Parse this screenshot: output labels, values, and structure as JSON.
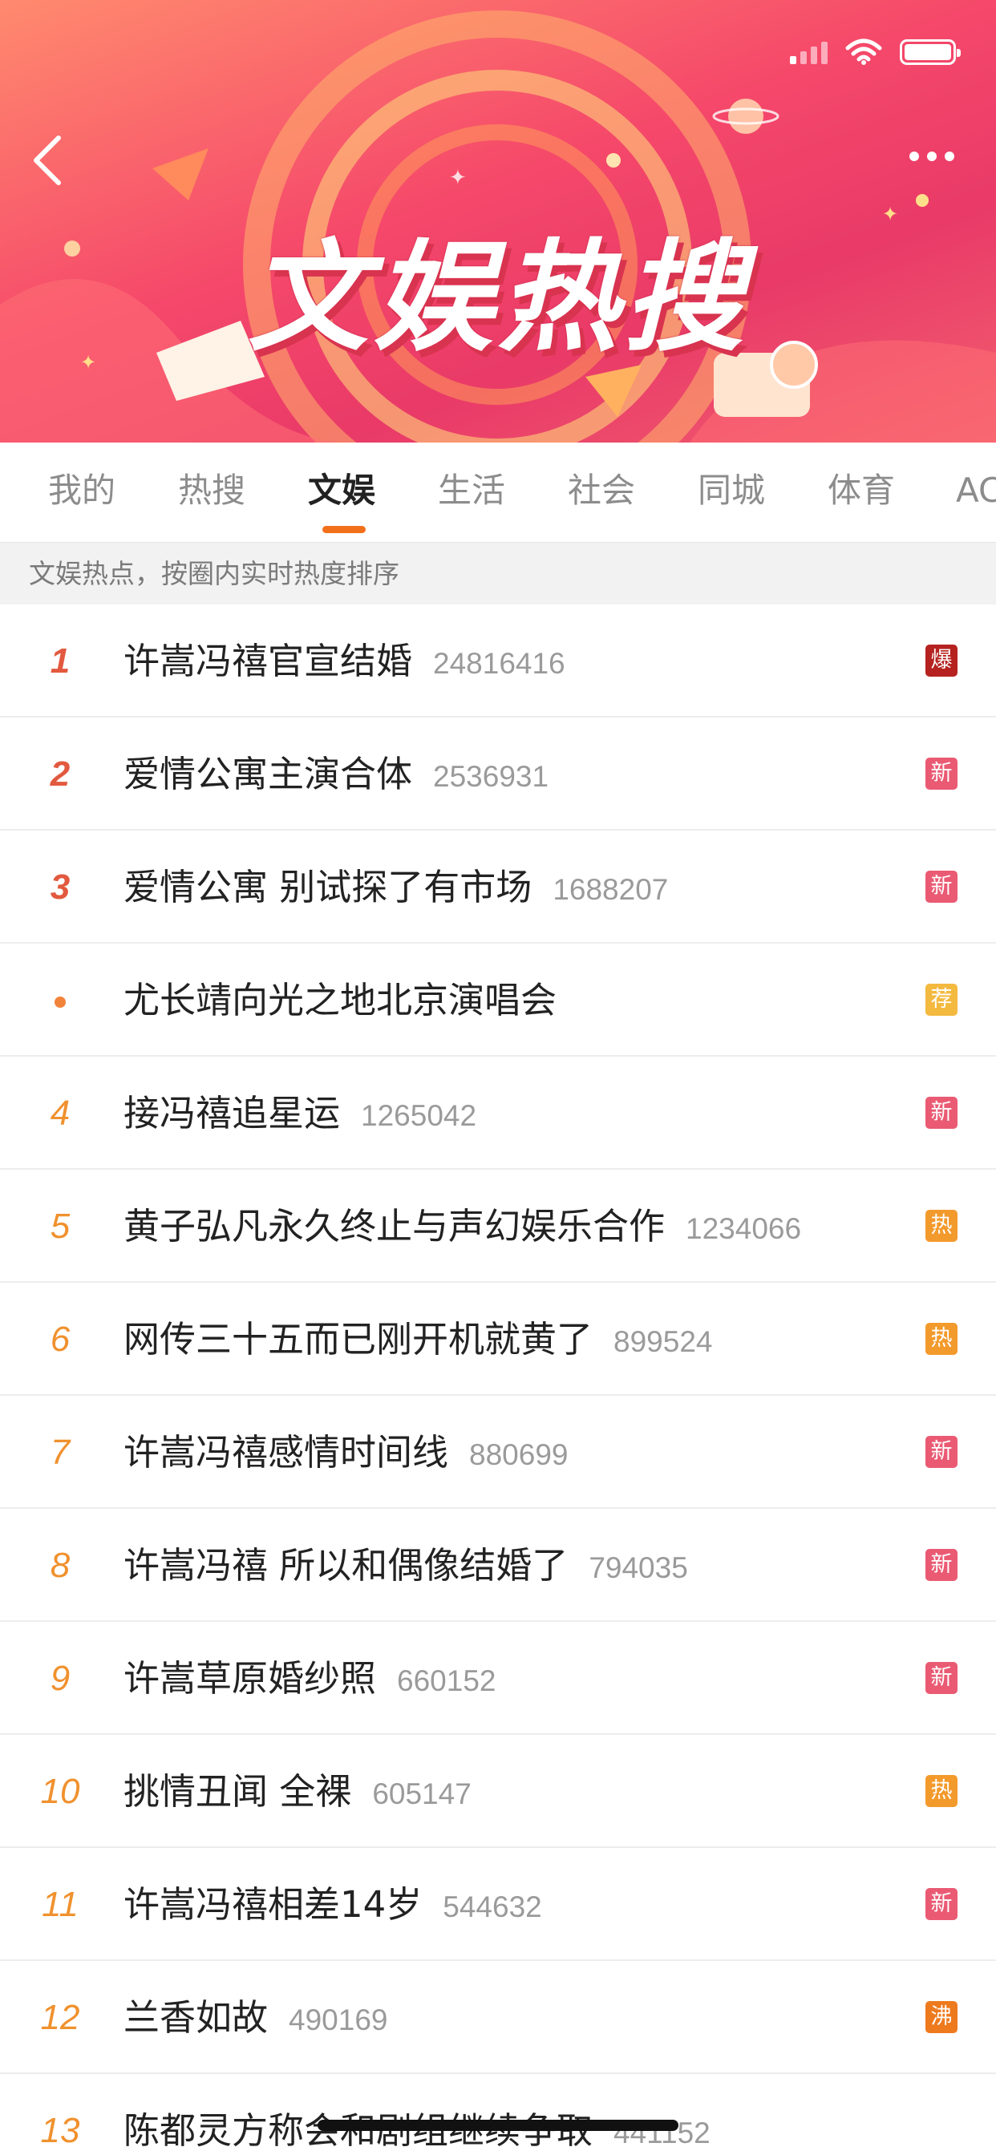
{
  "banner": {
    "title": "文娱热搜",
    "back_icon": "chevron-left-icon",
    "more_icon": "more-dots-icon",
    "colors": {
      "gradient_start": "#ff8a6e",
      "gradient_mid": "#f5486a",
      "gradient_end": "#e93a68"
    }
  },
  "tabs": [
    {
      "label": "我的",
      "active": false
    },
    {
      "label": "热搜",
      "active": false
    },
    {
      "label": "文娱",
      "active": true
    },
    {
      "label": "生活",
      "active": false
    },
    {
      "label": "社会",
      "active": false
    },
    {
      "label": "同城",
      "active": false
    },
    {
      "label": "体育",
      "active": false
    },
    {
      "label": "AC",
      "active": false
    }
  ],
  "subheader": {
    "text": "文娱热点，按圈内实时热度排序"
  },
  "accent_color": "#f2701a",
  "badge_colors": {
    "爆": "#b5221f",
    "新": "#ea5a73",
    "荐": "#f4b93f",
    "热": "#f39a2c",
    "沸": "#ee7a1e"
  },
  "list": [
    {
      "rank": "1",
      "title": "许嵩冯禧官宣结婚",
      "count": "24816416",
      "badge": "爆"
    },
    {
      "rank": "2",
      "title": "爱情公寓主演合体",
      "count": "2536931",
      "badge": "新"
    },
    {
      "rank": "3",
      "title": "爱情公寓 别试探了有市场",
      "count": "1688207",
      "badge": "新"
    },
    {
      "rank": "",
      "title": "尤长靖向光之地北京演唱会",
      "count": "",
      "badge": "荐"
    },
    {
      "rank": "4",
      "title": "接冯禧追星运",
      "count": "1265042",
      "badge": "新"
    },
    {
      "rank": "5",
      "title": "黄子弘凡永久终止与声幻娱乐合作",
      "count": "1234066",
      "badge": "热"
    },
    {
      "rank": "6",
      "title": "网传三十五而已刚开机就黄了",
      "count": "899524",
      "badge": "热"
    },
    {
      "rank": "7",
      "title": "许嵩冯禧感情时间线",
      "count": "880699",
      "badge": "新"
    },
    {
      "rank": "8",
      "title": "许嵩冯禧 所以和偶像结婚了",
      "count": "794035",
      "badge": "新"
    },
    {
      "rank": "9",
      "title": "许嵩草原婚纱照",
      "count": "660152",
      "badge": "新"
    },
    {
      "rank": "10",
      "title": "挑情丑闻 全裸",
      "count": "605147",
      "badge": "热"
    },
    {
      "rank": "11",
      "title": "许嵩冯禧相差14岁",
      "count": "544632",
      "badge": "新"
    },
    {
      "rank": "12",
      "title": "兰香如故",
      "count": "490169",
      "badge": "沸"
    },
    {
      "rank": "13",
      "title": "陈都灵方称会和剧组继续争取",
      "count": "441152",
      "badge": ""
    }
  ]
}
